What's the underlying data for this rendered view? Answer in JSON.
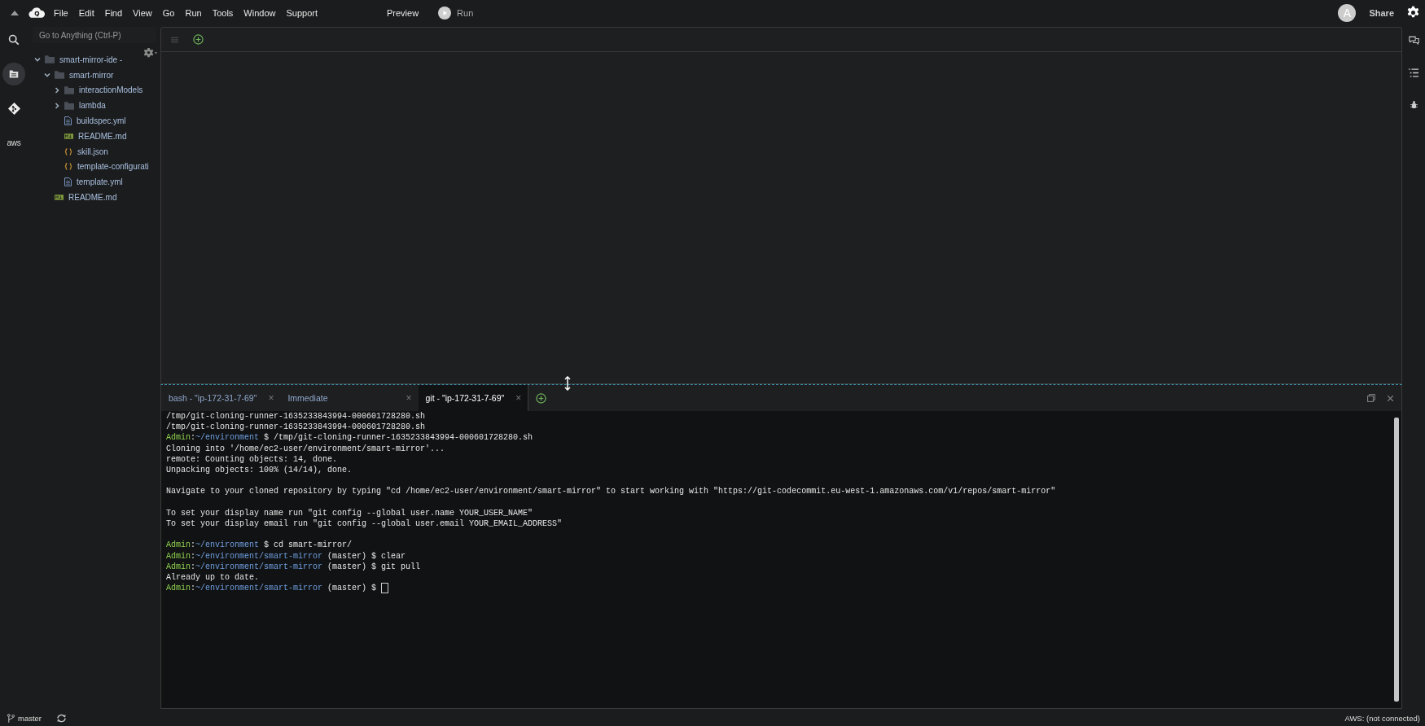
{
  "menu_bar": {
    "menus": [
      "File",
      "Edit",
      "Find",
      "View",
      "Go",
      "Run",
      "Tools",
      "Window",
      "Support"
    ],
    "preview": "Preview",
    "run": "Run",
    "avatar": "A",
    "share": "Share"
  },
  "activity_bar": [
    {
      "kind": "search",
      "selected": false
    },
    {
      "kind": "files",
      "selected": true
    },
    {
      "kind": "git",
      "selected": false
    },
    {
      "kind": "aws",
      "label": "aws",
      "selected": false
    }
  ],
  "sidebar": {
    "search": {
      "placeholder": "Go to Anything (Ctrl-P)"
    },
    "tree": [
      {
        "name": "smart-mirror-ide -",
        "kind": "folder",
        "expanded": true,
        "children": [
          {
            "name": "smart-mirror",
            "kind": "folder",
            "expanded": true,
            "children": [
              {
                "name": "interactionModels",
                "kind": "folder",
                "expanded": false
              },
              {
                "name": "lambda",
                "kind": "folder",
                "expanded": false
              },
              {
                "name": "buildspec.yml",
                "kind": "file"
              },
              {
                "name": "README.md",
                "kind": "markdown"
              },
              {
                "name": "skill.json",
                "kind": "json"
              },
              {
                "name": "template-configurati",
                "kind": "json"
              },
              {
                "name": "template.yml",
                "kind": "file"
              }
            ]
          },
          {
            "name": "README.md",
            "kind": "markdown"
          }
        ]
      }
    ]
  },
  "terminal": {
    "tabs": [
      {
        "label": "bash - \"ip-172-31-7-69\"",
        "close": "×",
        "selected": false
      },
      {
        "label": "Immediate",
        "close": "×",
        "selected": false
      },
      {
        "label": "git - \"ip-172-31-7-69\"",
        "close": "×",
        "selected": true
      }
    ],
    "lines": [
      {
        "kind": "output",
        "text": "/tmp/git-cloning-runner-1635233843994-000601728280.sh"
      },
      {
        "kind": "output",
        "text": "/tmp/git-cloning-runner-1635233843994-000601728280.sh"
      },
      {
        "kind": "prompt",
        "user": "Admin",
        "sep": ":",
        "path": "~/environment",
        "command": " $ /tmp/git-cloning-runner-1635233843994-000601728280.sh",
        "cursor": false
      },
      {
        "kind": "output",
        "text": "Cloning into '/home/ec2-user/environment/smart-mirror'..."
      },
      {
        "kind": "output",
        "text": "remote: Counting objects: 14, done."
      },
      {
        "kind": "output",
        "text": "Unpacking objects: 100% (14/14), done."
      },
      {
        "kind": "blank"
      },
      {
        "kind": "output",
        "text": "Navigate to your cloned repository by typing \"cd /home/ec2-user/environment/smart-mirror\" to start working with \"https://git-codecommit.eu-west-1.amazonaws.com/v1/repos/smart-mirror\""
      },
      {
        "kind": "blank"
      },
      {
        "kind": "output",
        "text": "To set your display name run \"git config --global user.name YOUR_USER_NAME\""
      },
      {
        "kind": "output",
        "text": "To set your display email run \"git config --global user.email YOUR_EMAIL_ADDRESS\""
      },
      {
        "kind": "blank"
      },
      {
        "kind": "prompt",
        "user": "Admin",
        "sep": ":",
        "path": "~/environment",
        "command": " $ cd smart-mirror/",
        "cursor": false
      },
      {
        "kind": "prompt",
        "user": "Admin",
        "sep": ":",
        "path": "~/environment/smart-mirror",
        "command": " (master) $ clear",
        "cursor": false
      },
      {
        "kind": "prompt",
        "user": "Admin",
        "sep": ":",
        "path": "~/environment/smart-mirror",
        "command": " (master) $ git pull",
        "cursor": false
      },
      {
        "kind": "output",
        "text": "Already up to date."
      },
      {
        "kind": "prompt",
        "user": "Admin",
        "sep": ":",
        "path": "~/environment/smart-mirror",
        "command": " (master) $",
        "cursor": true
      }
    ]
  },
  "status_bar": {
    "branch": "master",
    "aws_status": "AWS: (not connected)"
  }
}
